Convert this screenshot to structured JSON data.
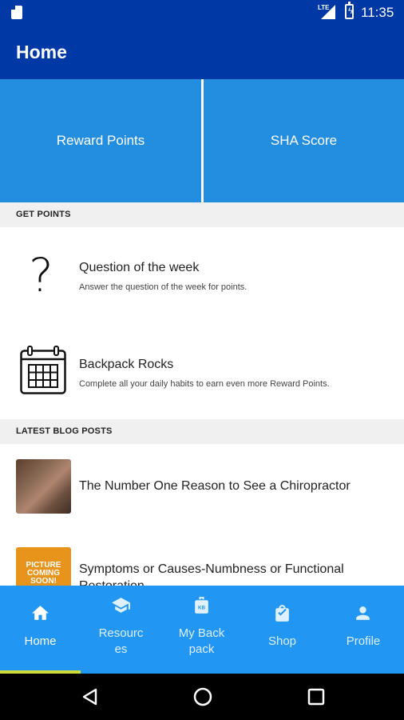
{
  "status_bar": {
    "network": "LTE",
    "time": "11:35"
  },
  "app_bar": {
    "title": "Home"
  },
  "tiles": {
    "left": "Reward Points",
    "right": "SHA Score"
  },
  "get_points": {
    "header": "GET POINTS",
    "items": [
      {
        "title": "Question of the week",
        "subtitle": "Answer the question of the week for points.",
        "icon": "question-mark-icon"
      },
      {
        "title": "Backpack Rocks",
        "subtitle": "Complete all your daily habits to earn even more Reward Points.",
        "icon": "calendar-icon"
      }
    ]
  },
  "blog": {
    "header": "LATEST BLOG POSTS",
    "posts": [
      {
        "title": "The Number One Reason to See a Chiropractor",
        "thumbnail": "photo"
      },
      {
        "title": "Symptoms or Causes-Numbness or Functional Restoration",
        "thumbnail": "placeholder",
        "thumbnail_text": "PICTURE COMING SOON!"
      }
    ]
  },
  "bottom_nav": {
    "items": [
      {
        "label": "Home",
        "icon": "home-icon",
        "active": true
      },
      {
        "label": "Resourc es",
        "icon": "graduation-cap-icon",
        "active": false
      },
      {
        "label": "My Back pack",
        "icon": "backpack-icon",
        "active": false
      },
      {
        "label": "Shop",
        "icon": "shopping-bag-icon",
        "active": false
      },
      {
        "label": "Profile",
        "icon": "person-icon",
        "active": false
      }
    ]
  },
  "colors": {
    "app_bar": "#0039a6",
    "tiles": "#238de0",
    "bottom_nav": "#2196f3",
    "active_indicator": "#cddc39"
  }
}
